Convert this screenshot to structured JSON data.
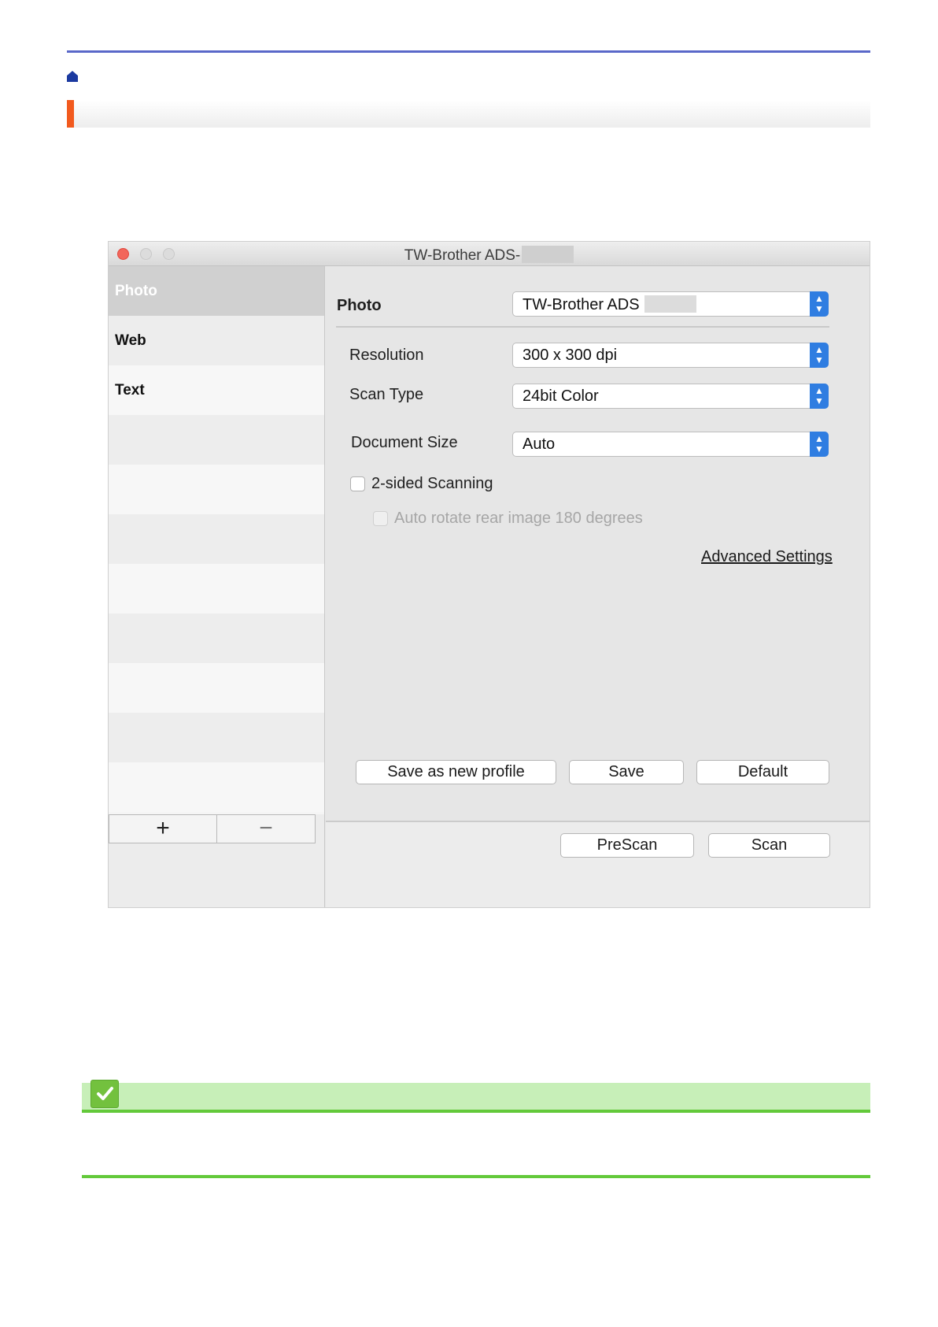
{
  "window": {
    "title": "TW-Brother ADS-",
    "traffic_lights": [
      "close",
      "minimize",
      "zoom"
    ]
  },
  "sidebar": {
    "items": [
      {
        "label": "Photo",
        "selected": true
      },
      {
        "label": "Web"
      },
      {
        "label": "Text"
      }
    ],
    "add_label": "+",
    "remove_label": "−"
  },
  "profile": {
    "name": "Photo",
    "scanner": "TW-Brother ADS"
  },
  "settings": {
    "resolution_label": "Resolution",
    "resolution_value": "300 x 300 dpi",
    "scan_type_label": "Scan Type",
    "scan_type_value": "24bit Color",
    "document_size_label": "Document Size",
    "document_size_value": "Auto",
    "two_sided_label": "2-sided Scanning",
    "auto_rotate_label": "Auto rotate rear image 180 degrees",
    "advanced_label": "Advanced Settings"
  },
  "buttons": {
    "save_new": "Save as new profile",
    "save": "Save",
    "default": "Default",
    "prescan": "PreScan",
    "scan": "Scan"
  },
  "colors": {
    "rule": "#5a68c9",
    "accent": "#f25a1e",
    "select_arrow": "#2f7de1",
    "note_bg": "#c7efb8",
    "note_line": "#63c93a"
  }
}
